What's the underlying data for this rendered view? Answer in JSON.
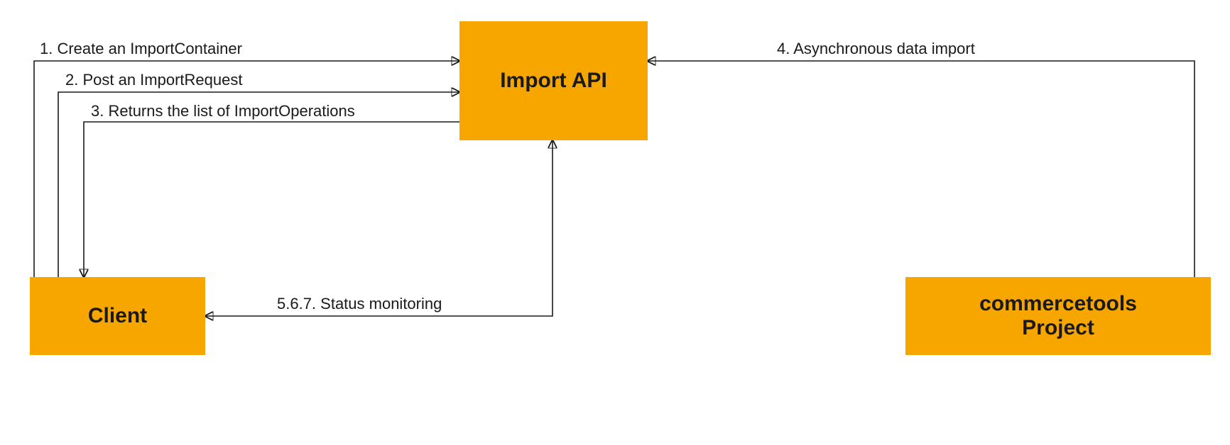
{
  "nodes": {
    "import_api": "Import API",
    "client": "Client",
    "ct_project_line1": "commercetools",
    "ct_project_line2": "Project"
  },
  "edges": {
    "step1": "1. Create an ImportContainer",
    "step2": "2. Post an ImportRequest",
    "step3": "3. Returns the list of ImportOperations",
    "step4": "4. Asynchronous data import",
    "step567": "5.6.7. Status monitoring"
  },
  "colors": {
    "node_fill": "#f7a600",
    "stroke": "#1a1a1a"
  }
}
